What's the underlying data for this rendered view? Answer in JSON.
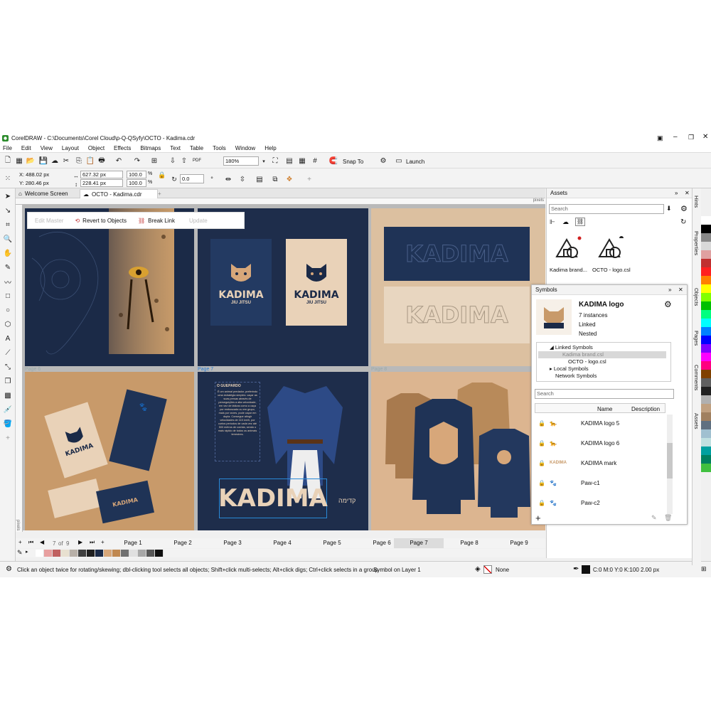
{
  "window": {
    "title": "CorelDRAW - C:\\Documents\\Corel Cloud\\p-Q-QSyfy\\OCTO - Kadima.cdr"
  },
  "menu": [
    "File",
    "Edit",
    "View",
    "Layout",
    "Object",
    "Effects",
    "Bitmaps",
    "Text",
    "Table",
    "Tools",
    "Window",
    "Help"
  ],
  "toolbar": {
    "zoom": "180%",
    "snap_label": "Snap To",
    "launch_label": "Launch"
  },
  "props": {
    "x": "X: 488.02 px",
    "y": "Y: 280.46 px",
    "w": "627.32 px",
    "h": "228.41 px",
    "sx": "100.0",
    "sy": "100.0",
    "pct": "%",
    "angle": "0.0"
  },
  "tabs": {
    "welcome": "Welcome Screen",
    "doc": "OCTO - Kadima.cdr"
  },
  "floatbar": {
    "edit": "Edit Master",
    "revert": "Revert to Objects",
    "break": "Break Link",
    "update": "Update"
  },
  "pages": {
    "labels": {
      "p6": "Page 6",
      "p7": "Page 7",
      "p8": "Page 8"
    },
    "content": {
      "brand": "KADIMA",
      "subtitle": "JIU JITSU",
      "article_title": "O GUEPARDO",
      "article_body": "É um animal predador, preferindo uma estratégia simples: caçar as suas presas através de perseguições a alta velocidade, em vez de táticas como a caça por emboscada ou em grupo, mais por vezes, pode caçar em dupla. Consegue atingir velocidades de 115 km/h, por curtos períodos de cada vez até 500 metros de corrida, sendo o mais rápido de todos os animais terrestres.",
      "hebrew": "קדימה"
    }
  },
  "pagenav": {
    "current": "7",
    "of": "of",
    "total": "9",
    "tabs": [
      "Page 1",
      "Page 2",
      "Page 3",
      "Page 4",
      "Page 5",
      "Page 6",
      "Page 7",
      "Page 8",
      "Page 9"
    ],
    "active_index": 6
  },
  "status": {
    "hint": "Click an object twice for rotating/skewing; dbl-clicking tool selects all objects; Shift+click multi-selects; Alt+click digs; Ctrl+click selects in a group",
    "selection": "Symbol on Layer 1",
    "fill": "None",
    "outline": "C:0 M:0 Y:0 K:100  2.00 px"
  },
  "assets": {
    "title": "Assets",
    "search_placeholder": "Search",
    "items": [
      "Kadima brand...",
      "OCTO - logo.csl"
    ]
  },
  "symbols": {
    "title": "Symbols",
    "selected": {
      "name": "KADIMA logo",
      "instances": "7 instances",
      "linked": "Linked",
      "nested": "Nested"
    },
    "tree": [
      "Linked Symbols",
      "Kadima brand.csl",
      "OCTO - logo.csl",
      "Local Symbols",
      "Network Symbols"
    ],
    "search_placeholder": "Search",
    "columns": {
      "name": "Name",
      "desc": "Description"
    },
    "list": [
      "KADIMA logo 5",
      "KADIMA logo 6",
      "KADIMA mark",
      "Paw-c1",
      "Paw-c2"
    ]
  },
  "righttabs": [
    "Hints",
    "Properties",
    "Objects",
    "Pages",
    "Comments",
    "Assets"
  ],
  "ruler_unit": "pixels",
  "colors": {
    "navy": "#1b2a47",
    "tan": "#d7a77a",
    "cream": "#e9d2b8",
    "palette": [
      "#ffffff",
      "#e8a0a0",
      "#c06060",
      "#e8e0d0",
      "#b8b0a8",
      "#404040",
      "#202020",
      "#1b2a47",
      "#d7a77a",
      "#c08850",
      "#707070",
      "#e0e0e0",
      "#a8a8a8",
      "#585858",
      "#101010"
    ],
    "strip": [
      "#ffffff",
      "#000000",
      "#888888",
      "#d9d9d9",
      "#e0a0a0",
      "#c03030",
      "#ff2020",
      "#ff8000",
      "#ffff00",
      "#80ff00",
      "#00c000",
      "#00ff80",
      "#00ffff",
      "#0080ff",
      "#0000ff",
      "#8000ff",
      "#ff00ff",
      "#ff0080",
      "#804000",
      "#606060",
      "#202020",
      "#b0b0b0",
      "#c0a080",
      "#a08060",
      "#607080",
      "#a0c0d0",
      "#c0e0e0",
      "#00a0a0",
      "#008060",
      "#40c040"
    ]
  }
}
